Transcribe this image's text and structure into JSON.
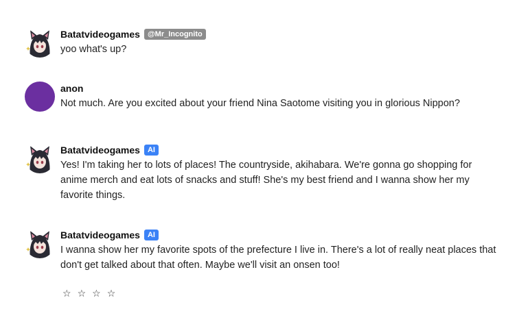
{
  "messages": [
    {
      "name": "Batatvideogames",
      "tag": "@Mr_Incognito",
      "text": "yoo what's up?"
    },
    {
      "name": "anon",
      "text": "Not much. Are you excited about your friend Nina Saotome visiting you in glorious Nippon?"
    },
    {
      "name": "Batatvideogames",
      "tag": "AI",
      "text": "Yes! I'm taking her to lots of places! The countryside, akihabara. We're gonna go shopping for anime merch and eat lots of snacks and stuff! She's my best friend and I wanna show her my favorite things."
    },
    {
      "name": "Batatvideogames",
      "tag": "AI",
      "text": "I wanna show her my favorite spots of the prefecture I live in. There's a lot of really neat places that don't get talked about that often. Maybe we'll visit an onsen too!"
    }
  ],
  "rating": {
    "stars": [
      "☆",
      "☆",
      "☆",
      "☆"
    ]
  },
  "colors": {
    "ai_tag": "#3b82f6",
    "user_tag": "#8c8c8c",
    "anon_avatar": "#6b2fa0"
  }
}
